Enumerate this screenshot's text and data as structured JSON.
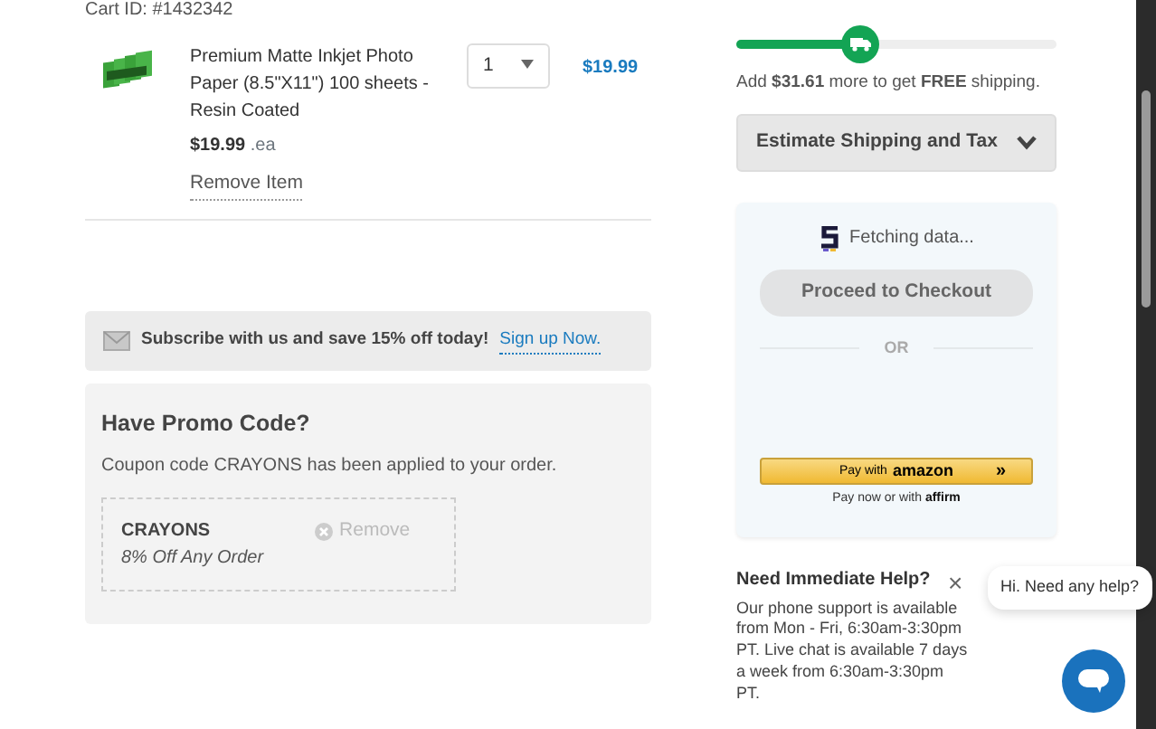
{
  "cart_id": "Cart ID: #1432342",
  "items": [
    {
      "title": "Premium Matte Inkjet Photo Paper (8.5\"X11\") 100 sheets - Resin Coated",
      "unit_price": "$19.99",
      "unit": ".ea",
      "quantity": "1",
      "total": "$19.99",
      "remove": "Remove Item"
    }
  ],
  "subscribe": {
    "text": "Subscribe with us and save 15% off today!",
    "link": "Sign up Now."
  },
  "promo": {
    "title": "Have Promo Code?",
    "message": "Coupon code CRAYONS has been applied to your order.",
    "code": "CRAYONS",
    "description": "8% Off Any Order",
    "remove": "Remove"
  },
  "shipping": {
    "level": 0.39,
    "message": "Add **$31.61** more to get **FREE** shipping.",
    "estimate": "Estimate Shipping and Tax",
    "expanded": false
  },
  "checkout": {
    "status": "Fetching data...",
    "button": "Proceed to Checkout",
    "separator": "OR",
    "amazon_prefix": "Pay with",
    "amazon_brand": "amazon",
    "amazon_arrow": "»",
    "affirm_text": "Pay now or with",
    "affirm_brand": "affirm"
  },
  "help": {
    "title": "Need Immediate Help?",
    "body": "Our phone support is available from Mon - Fri, 6:30am-3:30pm PT. Live chat is available 7 days a week from 6:30am-3:30pm PT."
  },
  "chat": {
    "greeting": "Hi. Need any help?",
    "close": "×"
  }
}
